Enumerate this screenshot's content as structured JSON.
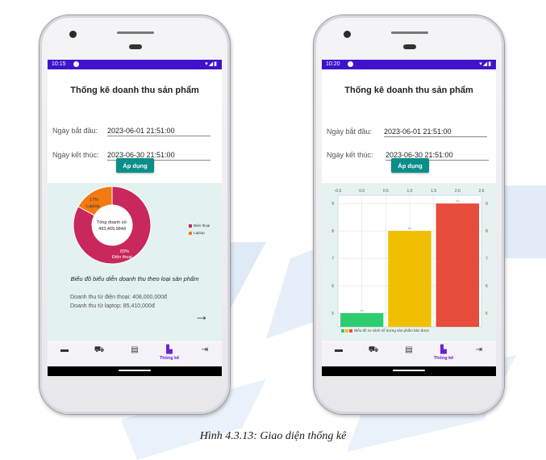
{
  "figure": {
    "caption": "Hình 4.3.13: Giao diện thống kê"
  },
  "left_phone": {
    "status_time": "10:15",
    "status_icons": "▾◢▮",
    "title": "Thống kê doanh thu sản phẩm",
    "start_label": "Ngày bắt đầu:",
    "start_value": "2023-06-01 21:51:00",
    "end_label": "Ngày kết thúc:",
    "end_value": "2023-06-30 21:51:00",
    "apply_label": "Áp dụng",
    "donut": {
      "center_line1": "Tổng doanh số:",
      "center_line2": "493,409,984đ",
      "slices": [
        {
          "name": "Điện thoại",
          "percent": 83,
          "label": "83%\nĐiện thoại",
          "color": "#c8285b"
        },
        {
          "name": "Laptop",
          "percent": 17,
          "label": "17%\nLaptop",
          "color": "#f27a10"
        }
      ],
      "slice_text_big": "83%",
      "slice_text_big_name": "Điện thoại",
      "slice_text_small": "17%",
      "slice_text_small_name": "Laptop"
    },
    "legend": [
      {
        "label": "Điện thoại",
        "color": "#c8285b"
      },
      {
        "label": "Laptop",
        "color": "#f27a10"
      }
    ],
    "chart_caption": "Biểu đồ biểu diễn doanh thu theo loại sản phẩm",
    "revenue_phone": "Doanh thu từ điện thoại: 408,000,000đ",
    "revenue_laptop": "Doanh thu từ laptop: 85,410,000đ",
    "next_arrow": "→",
    "nav": [
      {
        "icon": "chat-icon",
        "glyph": "▬",
        "label": ""
      },
      {
        "icon": "bag-icon",
        "glyph": "⛟",
        "label": ""
      },
      {
        "icon": "list-icon",
        "glyph": "▤",
        "label": ""
      },
      {
        "icon": "bar-chart-icon",
        "glyph": "▙",
        "label": "Thống kê"
      },
      {
        "icon": "logout-icon",
        "glyph": "⇥",
        "label": ""
      }
    ]
  },
  "right_phone": {
    "status_time": "10:20",
    "status_icons": "▾◢▮",
    "title": "Thống kê doanh thu sản phẩm",
    "start_label": "Ngày bắt đầu:",
    "start_value": "2023-06-01 21:51:00",
    "end_label": "Ngày kết thúc:",
    "end_value": "2023-06-30 21:51:00",
    "apply_label": "Áp dụng",
    "chart_legend_text": "Biểu đồ so sánh số lượng sản phẩm bán được",
    "nav": [
      {
        "icon": "chat-icon",
        "glyph": "▬",
        "label": ""
      },
      {
        "icon": "bag-icon",
        "glyph": "⛟",
        "label": ""
      },
      {
        "icon": "list-icon",
        "glyph": "▤",
        "label": ""
      },
      {
        "icon": "bar-chart-icon",
        "glyph": "▙",
        "label": "Thống kê"
      },
      {
        "icon": "logout-icon",
        "glyph": "⇥",
        "label": ""
      }
    ]
  },
  "chart_data": [
    {
      "type": "pie",
      "title": "",
      "center_text": "Tổng doanh số: 493,409,984đ",
      "categories": [
        "Điện thoại",
        "Laptop"
      ],
      "values": [
        83,
        17
      ],
      "colors": [
        "#c8285b",
        "#f27a10"
      ],
      "legend_position": "right",
      "annotation": "Biểu đồ biểu diễn doanh thu theo loại sản phẩm"
    },
    {
      "type": "bar",
      "title": "",
      "legend": "Biểu đồ so sánh số lượng sản phẩm bán được",
      "legend_position": "bottom-left",
      "x_ticks": [
        "-0.5",
        "0.0",
        "0.5",
        "1.0",
        "1.5",
        "2.0",
        "2.5"
      ],
      "xlim": [
        -0.5,
        2.5
      ],
      "ylim": [
        4.5,
        9.3
      ],
      "y_ticks": [
        "5",
        "6",
        "7",
        "8",
        "9"
      ],
      "grid": true,
      "series": [
        {
          "x": 0,
          "values": [
            5
          ],
          "color": "#2ecc71"
        },
        {
          "x": 1,
          "values": [
            8
          ],
          "color": "#f0c000"
        },
        {
          "x": 2,
          "values": [
            9
          ],
          "color": "#e74c3c"
        }
      ],
      "x": [
        0,
        1,
        2
      ],
      "values": [
        5,
        8,
        9
      ],
      "colors": [
        "#2ecc71",
        "#f0c000",
        "#e74c3c"
      ],
      "data_labels": [
        "5.0",
        "8.0",
        "9.0"
      ]
    }
  ]
}
